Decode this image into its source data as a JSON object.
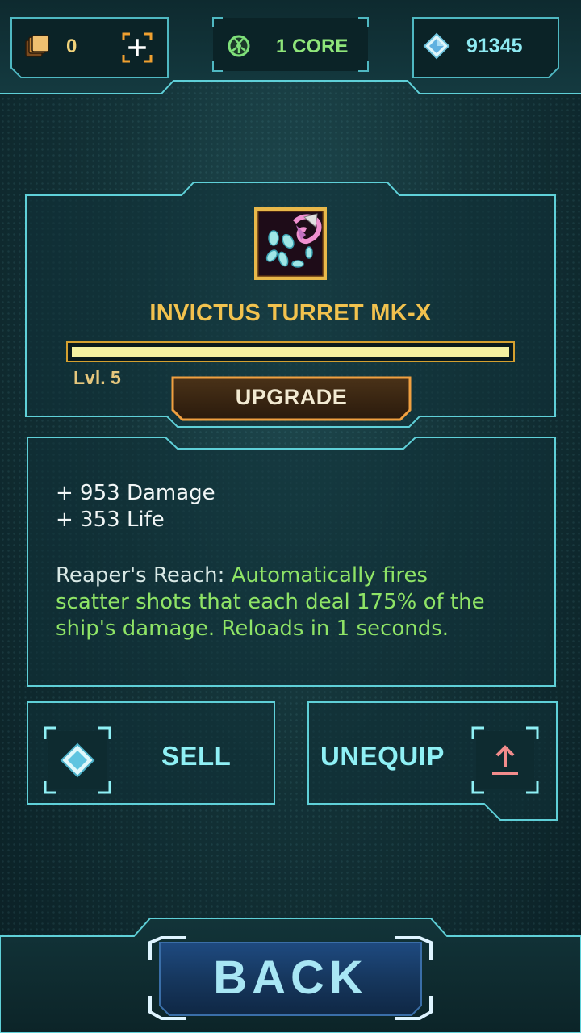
{
  "topbar": {
    "cards_count": "0",
    "core_label": "1 CORE",
    "gems_count": "91345",
    "icons": [
      "cards-icon",
      "add-cards-icon",
      "core-icon",
      "gem-icon"
    ]
  },
  "item": {
    "name": "INVICTUS TURRET MK-X",
    "level_label": "Lvl. 5",
    "level_progress": 1.0,
    "upgrade_label": "UPGRADE",
    "icon": "turret-scatter-icon"
  },
  "stats": {
    "damage_line": "+ 953 Damage",
    "life_line": "+ 353 Life",
    "ability_name": "Reaper's Reach: ",
    "ability_line1": "Automatically fires",
    "ability_line2": "scatter shots that each deal 175% of the",
    "ability_line3": "ship's damage. Reloads in 1 seconds."
  },
  "actions": {
    "sell_label": "SELL",
    "unequip_label": "UNEQUIP"
  },
  "footer": {
    "back_label": "BACK"
  },
  "colors": {
    "accent_frame": "#5fd0d8",
    "gold": "#f2c24e",
    "green": "#8fe466",
    "cyan_text": "#8ff0f5"
  }
}
